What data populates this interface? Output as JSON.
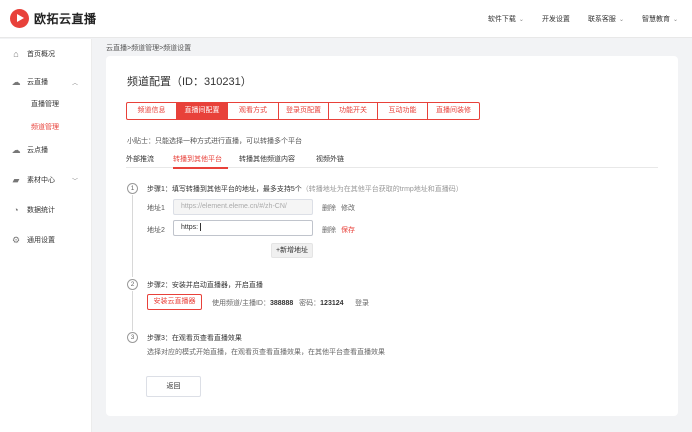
{
  "brand": {
    "name": "欧拓云直播",
    "color": "#e8413a"
  },
  "topnav": [
    {
      "label": "软件下载",
      "dropdown": true
    },
    {
      "label": "开发设置",
      "dropdown": false
    },
    {
      "label": "联系客服",
      "dropdown": true
    },
    {
      "label": "智慧教育",
      "dropdown": true
    }
  ],
  "sidebar": {
    "items": [
      {
        "label": "首页概况",
        "icon": "home-icon"
      },
      {
        "label": "云直播",
        "icon": "cloud-icon",
        "expanded": true
      },
      {
        "label": "云点播",
        "icon": "cloud-play-icon"
      },
      {
        "label": "素材中心",
        "icon": "folder-icon"
      },
      {
        "label": "数据统计",
        "icon": "chart-icon"
      },
      {
        "label": "通用设置",
        "icon": "gear-icon"
      }
    ],
    "sub_items": [
      {
        "label": "直播管理",
        "active": false
      },
      {
        "label": "频道管理",
        "active": true
      }
    ]
  },
  "breadcrumb": "云直播>频道管理>频道设置",
  "page_title": "频道配置（ID：310231）",
  "tabs": [
    {
      "label": "频道信息",
      "active": false
    },
    {
      "label": "直播间配置",
      "active": true
    },
    {
      "label": "观看方式",
      "active": false
    },
    {
      "label": "登录页配置",
      "active": false
    },
    {
      "label": "功能开关",
      "active": false
    },
    {
      "label": "互动功能",
      "active": false
    },
    {
      "label": "直播间装修",
      "active": false
    }
  ],
  "tip": "小贴士：只能选择一种方式进行直播，可以转播多个平台",
  "subtabs": [
    {
      "label": "外部推流",
      "active": false
    },
    {
      "label": "转播到其他平台",
      "active": true
    },
    {
      "label": "转播其他频道内容",
      "active": false
    },
    {
      "label": "视频外链",
      "active": false
    }
  ],
  "step1": {
    "num": "1",
    "title": "步骤1：填写转播到其他平台的地址，最多支持5个",
    "hint": "（转播地址为在其他平台获取的trmp地址和直播码）",
    "rows": [
      {
        "label": "地址1",
        "value": "https://element.eleme.cn/#/zh-CN/",
        "editing": false,
        "delete": "删除",
        "action": "修改"
      },
      {
        "label": "地址2",
        "value": "https:",
        "editing": true,
        "delete": "删除",
        "action": "保存"
      }
    ],
    "add_label": "+新增地址"
  },
  "step2": {
    "num": "2",
    "title": "步骤2：安装并启动直播器，开启直播",
    "install_label": "安装云直播器",
    "account_label": "使用频道/主播ID：",
    "account_value": "388888",
    "password_label": "密码：",
    "password_value": "123124",
    "login_label": "登录"
  },
  "step3": {
    "num": "3",
    "title": "步骤3：在观看页查看直播效果",
    "desc": "选择对应的模式开始直播，在观看页查看直播效果，在其他平台查看直播效果"
  },
  "back_label": "返回"
}
